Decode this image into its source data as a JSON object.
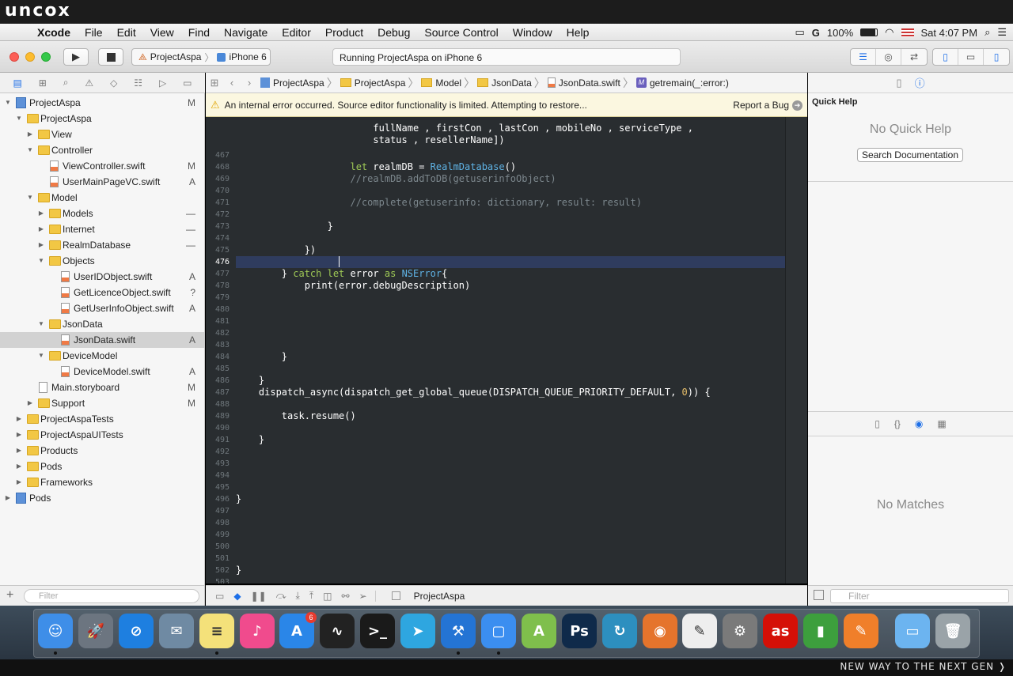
{
  "brand": {
    "logo": "uncox",
    "tagline": "NEW WAY TO THE NEXT GEN ❭"
  },
  "menubar": {
    "apple": "",
    "app": "Xcode",
    "items": [
      "File",
      "Edit",
      "View",
      "Find",
      "Navigate",
      "Editor",
      "Product",
      "Debug",
      "Source Control",
      "Window",
      "Help"
    ],
    "battery": "100%",
    "clock": "Sat 4:07 PM"
  },
  "toolbar": {
    "scheme_project": "ProjectAspa",
    "scheme_device": "iPhone 6",
    "activity": "Running ProjectAspa on iPhone 6"
  },
  "navigator": {
    "tree": [
      {
        "label": "ProjectAspa",
        "status": "M",
        "icon": "proj",
        "tri": "▼"
      },
      {
        "label": "ProjectAspa",
        "status": "",
        "icon": "folder",
        "tri": "▼"
      },
      {
        "label": "View",
        "status": "",
        "icon": "folder",
        "tri": "▶"
      },
      {
        "label": "Controller",
        "status": "",
        "icon": "folder",
        "tri": "▼"
      },
      {
        "label": "ViewController.swift",
        "status": "M",
        "icon": "swift",
        "tri": ""
      },
      {
        "label": "UserMainPageVC.swift",
        "status": "A",
        "icon": "swift",
        "tri": ""
      },
      {
        "label": "Model",
        "status": "",
        "icon": "folder",
        "tri": "▼"
      },
      {
        "label": "Models",
        "status": "—",
        "icon": "folder",
        "tri": "▶"
      },
      {
        "label": "Internet",
        "status": "—",
        "icon": "folder",
        "tri": "▶"
      },
      {
        "label": "RealmDatabase",
        "status": "—",
        "icon": "folder",
        "tri": "▶"
      },
      {
        "label": "Objects",
        "status": "",
        "icon": "folder",
        "tri": "▼"
      },
      {
        "label": "UserIDObject.swift",
        "status": "A",
        "icon": "swift",
        "tri": ""
      },
      {
        "label": "GetLicenceObject.swift",
        "status": "?",
        "icon": "swift",
        "tri": ""
      },
      {
        "label": "GetUserInfoObject.swift",
        "status": "A",
        "icon": "swift",
        "tri": ""
      },
      {
        "label": "JsonData",
        "status": "",
        "icon": "folder",
        "tri": "▼"
      },
      {
        "label": "JsonData.swift",
        "status": "A",
        "icon": "swift",
        "tri": ""
      },
      {
        "label": "DeviceModel",
        "status": "",
        "icon": "folder",
        "tri": "▼"
      },
      {
        "label": "DeviceModel.swift",
        "status": "A",
        "icon": "swift",
        "tri": ""
      },
      {
        "label": "Main.storyboard",
        "status": "M",
        "icon": "file",
        "tri": ""
      },
      {
        "label": "Support",
        "status": "M",
        "icon": "folder",
        "tri": "▶"
      },
      {
        "label": "ProjectAspaTests",
        "status": "",
        "icon": "folder",
        "tri": "▶"
      },
      {
        "label": "ProjectAspaUITests",
        "status": "",
        "icon": "folder",
        "tri": "▶"
      },
      {
        "label": "Products",
        "status": "",
        "icon": "folder",
        "tri": "▶"
      },
      {
        "label": "Pods",
        "status": "",
        "icon": "folder",
        "tri": "▶"
      },
      {
        "label": "Frameworks",
        "status": "",
        "icon": "folder",
        "tri": "▶"
      },
      {
        "label": "Pods",
        "status": "",
        "icon": "proj",
        "tri": "▶"
      }
    ],
    "filter_placeholder": "Filter"
  },
  "jumpbar": {
    "crumbs": [
      "ProjectAspa",
      "ProjectAspa",
      "Model",
      "JsonData",
      "JsonData.swift",
      "getremain(_:error:)"
    ]
  },
  "error_banner": {
    "message": "An internal error occurred. Source editor functionality is limited. Attempting to restore...",
    "report": "Report a Bug"
  },
  "editor": {
    "pre_lines": [
      "                                                     ",
      "                        fullName , firstCon , lastCon , mobileNo , serviceType ,",
      "                        status , resellerName])"
    ],
    "lines": [
      {
        "n": "467",
        "code": ""
      },
      {
        "n": "468",
        "code": "                    let realmDB = RealmDatabase()"
      },
      {
        "n": "469",
        "code": "                    //realmDB.addToDB(getuserinfoObject)"
      },
      {
        "n": "470",
        "code": ""
      },
      {
        "n": "471",
        "code": "                    //complete(getuserinfo: dictionary, result: result)"
      },
      {
        "n": "472",
        "code": ""
      },
      {
        "n": "473",
        "code": "                }"
      },
      {
        "n": "474",
        "code": ""
      },
      {
        "n": "475",
        "code": "            })"
      },
      {
        "n": "476",
        "code": ""
      },
      {
        "n": "477",
        "code": "        } catch let error as NSError{"
      },
      {
        "n": "478",
        "code": "            print(error.debugDescription)"
      },
      {
        "n": "479",
        "code": ""
      },
      {
        "n": "480",
        "code": ""
      },
      {
        "n": "481",
        "code": ""
      },
      {
        "n": "482",
        "code": ""
      },
      {
        "n": "483",
        "code": ""
      },
      {
        "n": "484",
        "code": "        }"
      },
      {
        "n": "485",
        "code": ""
      },
      {
        "n": "486",
        "code": "    }"
      },
      {
        "n": "487",
        "code": "    dispatch_async(dispatch_get_global_queue(DISPATCH_QUEUE_PRIORITY_DEFAULT, 0)) {"
      },
      {
        "n": "488",
        "code": ""
      },
      {
        "n": "489",
        "code": "        task.resume()"
      },
      {
        "n": "490",
        "code": ""
      },
      {
        "n": "491",
        "code": "    }"
      },
      {
        "n": "492",
        "code": ""
      },
      {
        "n": "493",
        "code": ""
      },
      {
        "n": "494",
        "code": ""
      },
      {
        "n": "495",
        "code": ""
      },
      {
        "n": "496",
        "code": "}"
      },
      {
        "n": "497",
        "code": ""
      },
      {
        "n": "498",
        "code": ""
      },
      {
        "n": "499",
        "code": ""
      },
      {
        "n": "500",
        "code": ""
      },
      {
        "n": "501",
        "code": ""
      },
      {
        "n": "502",
        "code": "}"
      },
      {
        "n": "503",
        "code": ""
      }
    ],
    "current_line": "476"
  },
  "debugbar": {
    "target": "ProjectAspa"
  },
  "inspector": {
    "quick_help_title": "Quick Help",
    "no_quick_help": "No Quick Help",
    "search_docs": "Search Documentation",
    "no_matches": "No Matches",
    "filter_placeholder": "Filter"
  },
  "dock": {
    "apps": [
      {
        "name": "finder",
        "color": "#3e8ee8",
        "glyph": "☺",
        "running": true
      },
      {
        "name": "launchpad",
        "color": "#6c7580",
        "glyph": "🚀",
        "running": false
      },
      {
        "name": "safari",
        "color": "#1e7fe0",
        "glyph": "⊘",
        "running": false
      },
      {
        "name": "preview",
        "color": "#6f8aa3",
        "glyph": "✉",
        "running": false
      },
      {
        "name": "notes",
        "color": "#f4e17a",
        "glyph": "≡",
        "running": true
      },
      {
        "name": "itunes",
        "color": "#f04b8d",
        "glyph": "♪",
        "running": false
      },
      {
        "name": "app-store",
        "color": "#2a86e8",
        "glyph": "A",
        "running": false,
        "badge": "6"
      },
      {
        "name": "activity-monitor",
        "color": "#222",
        "glyph": "∿",
        "running": false
      },
      {
        "name": "terminal",
        "color": "#1a1a1a",
        "glyph": ">_",
        "running": false
      },
      {
        "name": "telegram",
        "color": "#2ea6e0",
        "glyph": "➤",
        "running": false
      },
      {
        "name": "xcode",
        "color": "#2474d4",
        "glyph": "⚒",
        "running": true
      },
      {
        "name": "simulator",
        "color": "#3b8ef0",
        "glyph": "▢",
        "running": true
      },
      {
        "name": "android-studio",
        "color": "#7fbf4c",
        "glyph": "A",
        "running": false
      },
      {
        "name": "photoshop",
        "color": "#0f2a4a",
        "glyph": "Ps",
        "running": false
      },
      {
        "name": "sourcetree",
        "color": "#2d8fbf",
        "glyph": "↻",
        "running": false
      },
      {
        "name": "firefox",
        "color": "#e5742c",
        "glyph": "◉",
        "running": false
      },
      {
        "name": "textedit",
        "color": "#eeeeee",
        "glyph": "✎",
        "running": false
      },
      {
        "name": "system-preferences",
        "color": "#7a7a7a",
        "glyph": "⚙",
        "running": false
      },
      {
        "name": "lastfm",
        "color": "#d51007",
        "glyph": "as",
        "running": false
      },
      {
        "name": "numbers",
        "color": "#3d9f3d",
        "glyph": "▮",
        "running": false
      },
      {
        "name": "instruments",
        "color": "#f07f2a",
        "glyph": "✎",
        "running": false
      },
      {
        "name": "downloads-folder",
        "color": "#6cb4f0",
        "glyph": "▭",
        "running": false
      },
      {
        "name": "trash",
        "color": "#9aa3a8",
        "glyph": "🗑",
        "running": false
      }
    ]
  },
  "colors": {
    "accent": "#1d6fe8",
    "editor_bg": "#292d30",
    "keyword": "#9fca56",
    "type": "#5fb3e5",
    "comment": "#7c878d",
    "number": "#e8bf6a"
  }
}
